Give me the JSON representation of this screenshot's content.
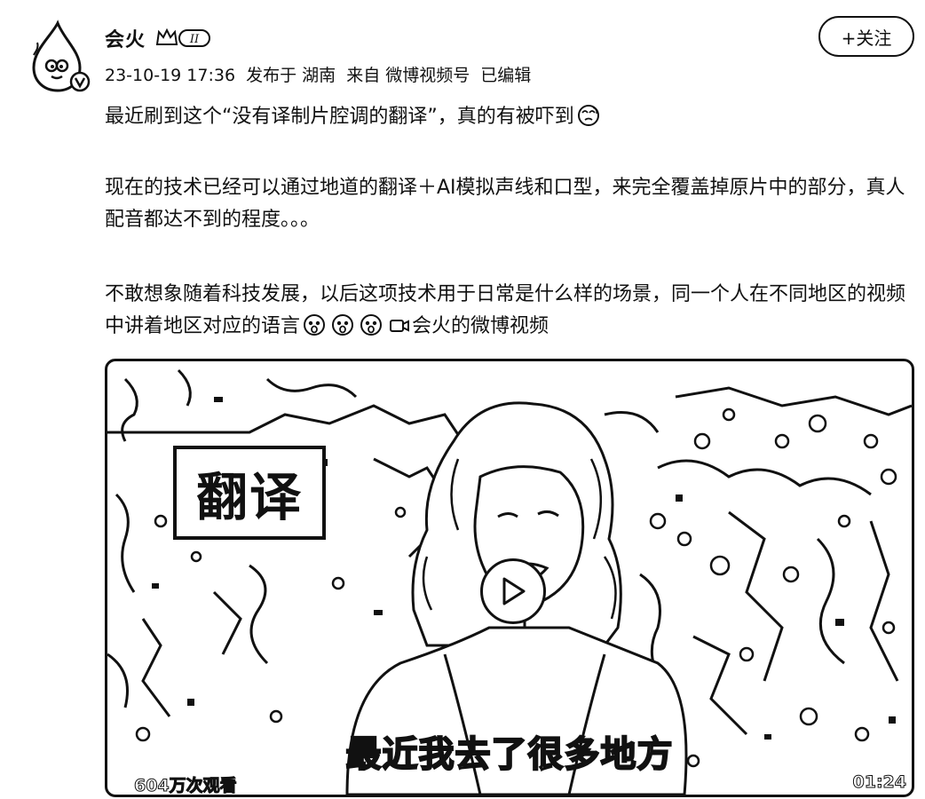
{
  "author": {
    "name": "会火",
    "avatar_icon": "flame-mascot-avatar-icon",
    "verified_icon": "verified-v-icon",
    "level_badge_icon": "crown-level-badge-icon",
    "level_text": "II"
  },
  "meta": {
    "time": "23-10-19 17:36",
    "location": "发布于 湖南",
    "source": "来自 微博视频号",
    "edited": "已编辑"
  },
  "follow_button": {
    "label": "+关注"
  },
  "post": {
    "line1": "最近刷到这个“没有译制片腔调的翻译”，真的有被吓到",
    "line1_emoji": "dizzy-face-emoji-icon",
    "paragraph2": "现在的技术已经可以通过地道的翻译＋AI模拟声线和口型，来完全覆盖掉原片中的部分，真人配音都达不到的程度。。。",
    "paragraph3": "不敢想象随着科技发展，以后这项技术用于日常是什么样的场景，同一个人在不同地区的视频中讲着地区对应的语言",
    "paragraph3_emojis": [
      "surprised-face-emoji-icon",
      "surprised-face-emoji-icon",
      "surprised-face-emoji-icon"
    ],
    "video_link_icon": "video-camera-icon",
    "video_link_text": "会火的微博视频"
  },
  "video": {
    "overlay_title": "翻译",
    "subtitle": "最近我去了很多地方",
    "view_count": "604万次观看",
    "duration": "01:24",
    "play_icon": "play-icon"
  }
}
